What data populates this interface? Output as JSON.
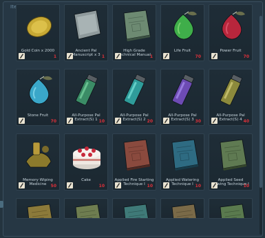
{
  "panel": {
    "title": "Item List"
  },
  "items": [
    {
      "name": "Gold Coin x 2000",
      "qty": "1",
      "art": "coin"
    },
    {
      "name": "Ancient Pal Manuscript x 3",
      "qty": "1",
      "art": "scroll"
    },
    {
      "name": "High Grade Technical Manual",
      "qty": "1",
      "art": "book-green"
    },
    {
      "name": "Life Fruit",
      "qty": "70",
      "art": "fruit-green"
    },
    {
      "name": "Power Fruit",
      "qty": "70",
      "art": "fruit-red"
    },
    {
      "name": "Stone Fruit",
      "qty": "70",
      "art": "fruit-blue"
    },
    {
      "name": "All-Purpose Pal Extract(S) 1",
      "qty": "10",
      "art": "vial-green"
    },
    {
      "name": "All-Purpose Pal Extract(S) 2",
      "qty": "20",
      "art": "vial-teal"
    },
    {
      "name": "All-Purpose Pal Extract(S) 3",
      "qty": "30",
      "art": "vial-purple"
    },
    {
      "name": "All-Purpose Pal Extract(S) 4",
      "qty": "40",
      "art": "vial-gold"
    },
    {
      "name": "Memory Wiping Medicine",
      "qty": "50",
      "art": "medicine"
    },
    {
      "name": "Cake",
      "qty": "10",
      "art": "cake"
    },
    {
      "name": "Applied Fire Starting Technique I",
      "qty": "10",
      "art": "book-red"
    },
    {
      "name": "Applied Watering Technique I",
      "qty": "10",
      "art": "book-blue"
    },
    {
      "name": "Applied Seed Sowing Technique I",
      "qty": "10",
      "art": "book-olive"
    },
    {
      "name": "",
      "qty": "",
      "art": "book-gold-partial"
    },
    {
      "name": "",
      "qty": "",
      "art": "book-olive-partial"
    },
    {
      "name": "",
      "qty": "",
      "art": "book-teal-partial"
    },
    {
      "name": "",
      "qty": "",
      "art": "book-brown-partial"
    },
    {
      "name": "",
      "qty": "",
      "art": "book-green-partial"
    }
  ],
  "colors": {
    "qty": "#e0303a",
    "panel": "#263744",
    "slot": "#1d2b35"
  }
}
